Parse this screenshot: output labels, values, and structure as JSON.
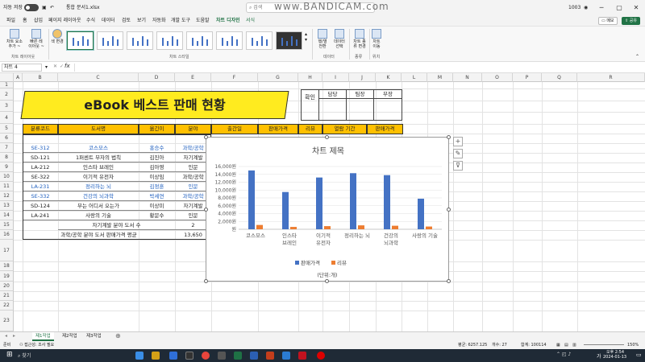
{
  "titlebar": {
    "autosave": "자동 저장",
    "doc_title": "통합 문서1.xlsx",
    "search_placeholder": "검색",
    "watermark": "www.BANDICAM.com",
    "user": "1003"
  },
  "menu": {
    "items": [
      "파일",
      "홈",
      "삽입",
      "페이지 레이아웃",
      "수식",
      "데이터",
      "검토",
      "보기",
      "자동화",
      "개발 도구",
      "도움말",
      "차트 디자인",
      "서식"
    ],
    "memo_label": "메모",
    "share_label": "공유"
  },
  "ribbon": {
    "add_element": "차트 요소\n추가 ~",
    "quick_layout": "빠른 레\n이아웃 ~",
    "change_color": "색 변경",
    "group_layout": "차트 레이아웃",
    "group_styles": "차트 스타일",
    "switch_rowcol": "행/열\n전환",
    "select_data": "데이터\n선택",
    "group_data": "데이터",
    "change_type": "차트 종\n류 변경",
    "group_type": "종류",
    "move_chart": "차트\n이동",
    "group_location": "위치"
  },
  "formula_bar": {
    "name_box": "차트 4",
    "fx": "fx"
  },
  "columns": [
    "A",
    "B",
    "C",
    "D",
    "E",
    "F",
    "G",
    "H",
    "I",
    "J",
    "K",
    "L",
    "M",
    "N",
    "O",
    "P",
    "Q",
    "R"
  ],
  "rows": [
    "1",
    "2",
    "3",
    "4",
    "5",
    "6",
    "7",
    "8",
    "9",
    "10",
    "11",
    "12",
    "13",
    "14",
    "15",
    "16",
    "17",
    "18",
    "19",
    "20",
    "21",
    "22",
    "23"
  ],
  "sheet": {
    "title": "eBook 베스트 판매 현황",
    "approval": {
      "label": "확인",
      "headers": [
        "담당",
        "팀장",
        "부장"
      ]
    },
    "headers": [
      "분류코드",
      "도서명",
      "옮긴이",
      "분야",
      "출간일",
      "판매가격",
      "리뷰",
      "열람 기간",
      "판매가격"
    ],
    "rows": [
      [
        "SE-312",
        "코스모스",
        "홍승수",
        "과학/공학"
      ],
      [
        "SD-121",
        "1퍼센트 부자의 법칙",
        "김진아",
        "자기계발"
      ],
      [
        "LA-212",
        "인스타 브레인",
        "김아영",
        "인문"
      ],
      [
        "SE-322",
        "이기적 유전자",
        "이상임",
        "과학/공학"
      ],
      [
        "LA-231",
        "정리하는 뇌",
        "김정훈",
        "인문"
      ],
      [
        "SE-332",
        "건강의 뇌과학",
        "박세연",
        "과학/공학"
      ],
      [
        "SD-124",
        "부는 어디서 오는가",
        "이상미",
        "자기계발"
      ],
      [
        "LA-241",
        "사랑의 기술",
        "황문수",
        "인문"
      ]
    ],
    "summary1_label": "자기계발 분야 도서 수",
    "summary1_value": "2",
    "summary2_label": "과학/공학 분야 도서 판매가격 평균",
    "summary2_value": "13,650"
  },
  "chart_data": {
    "type": "bar",
    "title": "차트 제목",
    "categories": [
      "코스모스",
      "인스타 브레인",
      "이기적 유전자",
      "정리하는 뇌",
      "건강의 뇌과학",
      "사랑의 기술"
    ],
    "category_lines": [
      [
        "코스모스"
      ],
      [
        "인스타",
        "브레인"
      ],
      [
        "이기적",
        "유전자"
      ],
      [
        "정리하는 뇌"
      ],
      [
        "건강의",
        "뇌과학"
      ],
      [
        "사랑의 기술"
      ]
    ],
    "series": [
      {
        "name": "판매가격",
        "values": [
          15000,
          9500,
          13200,
          14300,
          13800,
          7800
        ],
        "color": "#4472c4"
      },
      {
        "name": "리뷰",
        "values": [
          1100,
          600,
          800,
          1000,
          900,
          700
        ],
        "color": "#ed7d31"
      }
    ],
    "ylim": [
      0,
      16000
    ],
    "yticks": [
      "원",
      "2,000원",
      "4,000원",
      "6,000원",
      "8,000원",
      "10,000원",
      "12,000원",
      "14,000원",
      "16,000원"
    ],
    "axis_note": "(단위:개)",
    "legend": "bottom",
    "grid": true
  },
  "tabs": [
    "제1작업",
    "제2작업",
    "제3작업"
  ],
  "status": {
    "ready": "준비",
    "accessibility": "접근성: 조사 필요",
    "average": "평균: 6257.125",
    "count": "개수: 27",
    "sum": "합계: 100114",
    "zoom": "150%"
  },
  "taskbar": {
    "search": "찾기",
    "time": "오후 2:54",
    "date": "2024-01-13",
    "ime": "가"
  }
}
